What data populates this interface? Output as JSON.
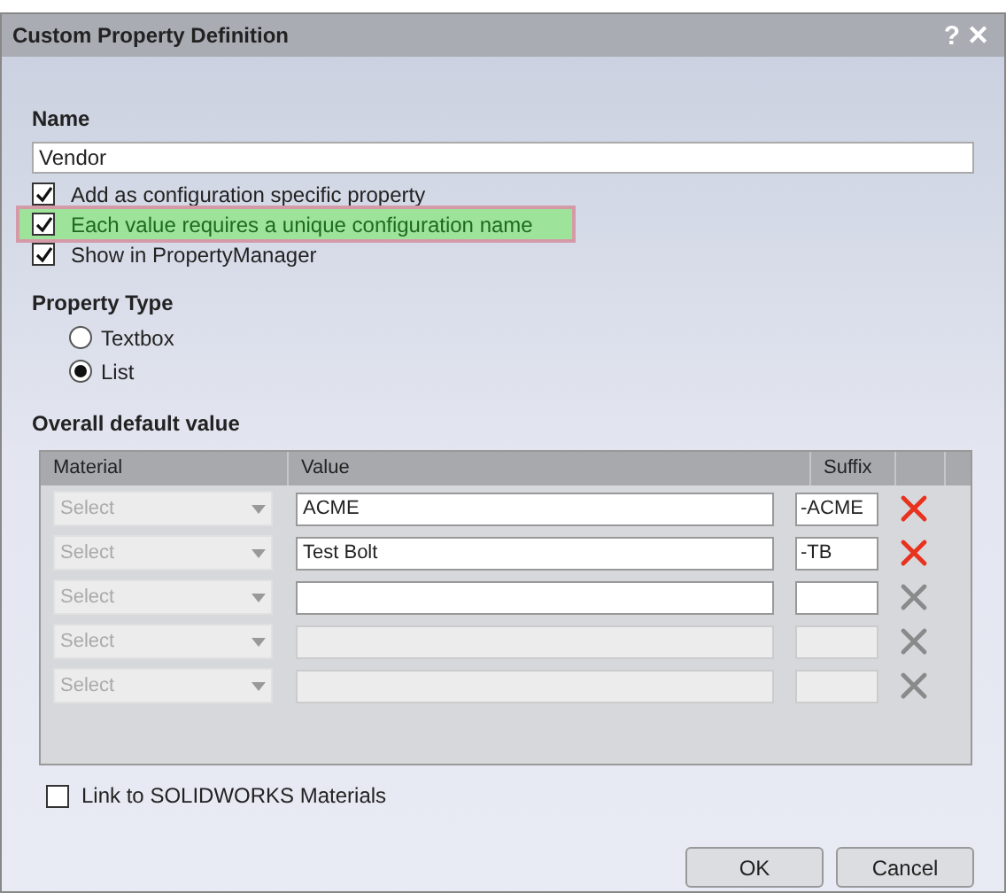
{
  "window": {
    "title": "Custom Property Definition",
    "buttons": [
      "?",
      "✕"
    ]
  },
  "name_field": {
    "label": "Name",
    "value": "Vendor"
  },
  "options": [
    {
      "label": "Add as configuration specific property",
      "checked": true,
      "highlighted": false
    },
    {
      "label": "Each value requires a unique configuration name",
      "checked": true,
      "highlighted": true
    },
    {
      "label": "Show in PropertyManager",
      "checked": true,
      "highlighted": false
    }
  ],
  "property_type": {
    "label": "Property Type",
    "choices": [
      {
        "label": "Textbox",
        "selected": false
      },
      {
        "label": "List",
        "selected": true
      }
    ]
  },
  "default_value": {
    "label": "Overall default value",
    "columns": [
      "Material",
      "Value",
      "Suffix"
    ],
    "rows": [
      {
        "material": "Select",
        "value": "ACME",
        "suffix": "-ACME",
        "disabled": false,
        "delete_enabled": true
      },
      {
        "material": "Select",
        "value": "Test Bolt",
        "suffix": "-TB",
        "disabled": false,
        "delete_enabled": true
      },
      {
        "material": "Select",
        "disabled": false,
        "delete_enabled": false
      },
      {
        "material": "Select",
        "disabled": true,
        "delete_enabled": false
      },
      {
        "material": "Select",
        "disabled": true,
        "delete_enabled": false
      }
    ]
  },
  "link_option": {
    "label": "Link to SOLIDWORKS Materials",
    "checked": false
  },
  "buttons": [
    "OK",
    "Cancel"
  ]
}
